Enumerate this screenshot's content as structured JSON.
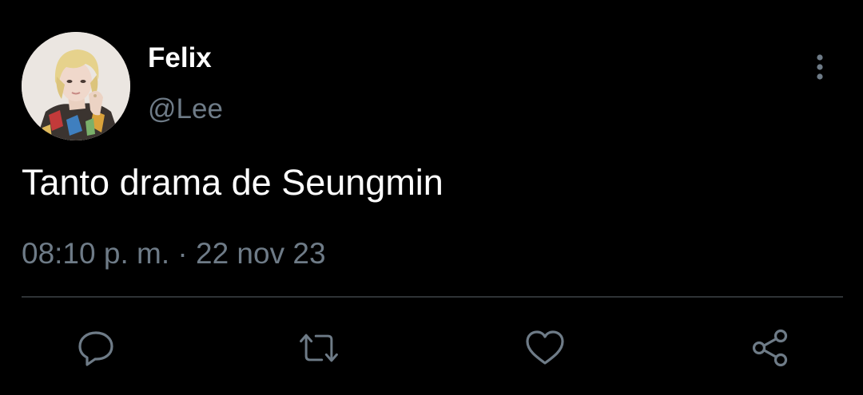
{
  "tweet": {
    "display_name": "Felix",
    "handle": "@Lee",
    "text": "Tanto drama de Seungmin",
    "time": "08:10 p. m.",
    "separator": "·",
    "date": "22 nov 23"
  },
  "icons": {
    "avatar": "profile-photo",
    "more": "more-vertical-icon",
    "reply": "reply-icon",
    "retweet": "retweet-icon",
    "like": "heart-icon",
    "share": "share-icon"
  },
  "colors": {
    "background": "#000000",
    "primary_text": "#ffffff",
    "secondary_text": "#6e7b87",
    "divider": "#2f3336"
  }
}
